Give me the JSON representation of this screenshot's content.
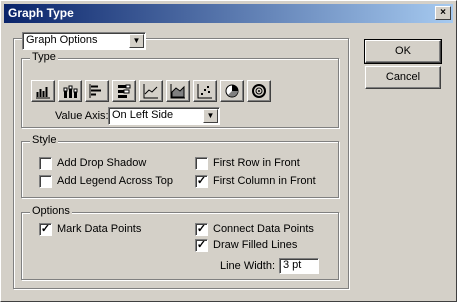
{
  "window": {
    "title": "Graph Type",
    "close_glyph": "×"
  },
  "top_select": {
    "value": "Graph Options"
  },
  "type_group": {
    "label": "Type",
    "buttons": [
      "grouped-column-icon",
      "stacked-column-icon",
      "grouped-bar-icon",
      "stacked-bar-icon",
      "line-graph-icon",
      "area-graph-icon",
      "scatter-graph-icon",
      "pie-graph-icon",
      "radar-graph-icon"
    ],
    "value_axis_label": "Value Axis:",
    "value_axis_value": "On Left Side"
  },
  "style_group": {
    "label": "Style",
    "add_drop_shadow": {
      "label": "Add Drop Shadow",
      "checked": false
    },
    "add_legend": {
      "label": "Add Legend Across Top",
      "checked": false
    },
    "first_row_front": {
      "label": "First Row in Front",
      "checked": false
    },
    "first_column_front": {
      "label": "First Column in Front",
      "checked": true
    }
  },
  "options_group": {
    "label": "Options",
    "mark_data_points": {
      "label": "Mark Data Points",
      "checked": true
    },
    "connect_data_points": {
      "label": "Connect Data Points",
      "checked": true
    },
    "draw_filled_lines": {
      "label": "Draw Filled Lines",
      "checked": true
    },
    "line_width_label": "Line Width:",
    "line_width_value": "3 pt"
  },
  "buttons": {
    "ok": "OK",
    "cancel": "Cancel"
  },
  "check_glyph": "✓"
}
